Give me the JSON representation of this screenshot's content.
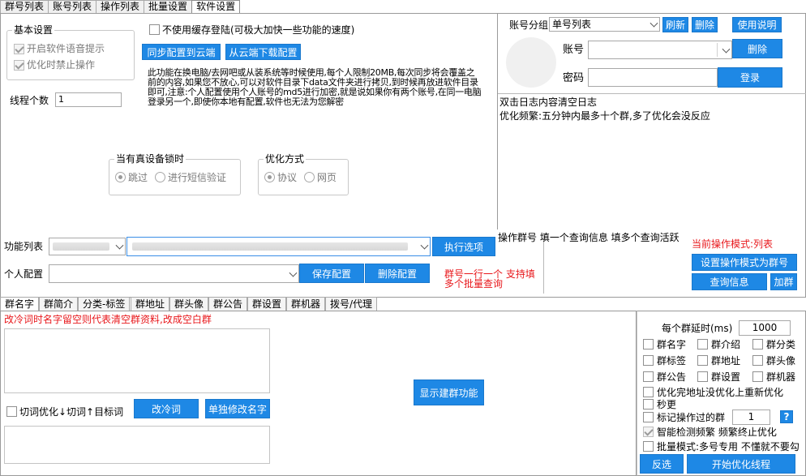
{
  "tabs": [
    "群号列表",
    "账号列表",
    "操作列表",
    "批量设置",
    "软件设置"
  ],
  "settings": {
    "basic_title": "基本设置",
    "voice_prompt": "开启软件语音提示",
    "forbid_optimize": "优化时禁止操作",
    "no_cache_login": "不使用缓存登陆(可极大加快一些功能的速度)",
    "sync_to_cloud": "同步配置到云端",
    "download_from_cloud": "从云端下载配置",
    "description": "此功能在换电脑/去网吧或从装系统等时候使用,每个人限制20MB,每次同步将会覆盖之前的内容,如果您不放心,可以对软件目录下data文件夹进行拷贝,到时候再放进软件目录即可,注意:个人配置使用个人账号的md5进行加密,就是说如果你有两个账号,在同一电脑登录另一个,即使你本地有配置,软件也无法为您解密",
    "thread_label": "线程个数",
    "thread_value": "1",
    "device_lock_title": "当有真设备锁时",
    "skip_label": "跳过",
    "sms_label": "进行短信验证",
    "optimize_mode_title": "优化方式",
    "protocol_label": "协议",
    "web_label": "网页"
  },
  "account": {
    "group_label": "账号分组",
    "group_value": "单号列表",
    "refresh": "刷新",
    "delete": "删除",
    "instructions": "使用说明",
    "account_label": "账号",
    "delete2": "删除",
    "password_label": "密码",
    "login": "登录"
  },
  "log": {
    "line1": "双击日志内容清空日志",
    "line2": "优化频繁:五分钟内最多十个群,多了优化会没反应"
  },
  "func": {
    "func_list_label": "功能列表",
    "execute": "执行选项",
    "personal_label": "个人配置",
    "save_config": "保存配置",
    "delete_config": "删除配置",
    "hint": "群号一行一个 支持填多个批量查询",
    "op_group_header": "操作群号 填一个查询信息 填多个查询活跃",
    "current_mode": "当前操作模式:列表",
    "set_mode": "设置操作模式为群号",
    "query_info": "查询信息",
    "join_group": "加群"
  },
  "bottom_tabs": [
    "群名字",
    "群简介",
    "分类-标签",
    "群地址",
    "群头像",
    "群公告",
    "群设置",
    "群机器",
    "拨号/代理"
  ],
  "bottom": {
    "red_note": "改冷词时名字留空则代表清空群资料,改成空白群",
    "cut_words": "切词优化↓切词↑目标词",
    "change_cold": "改冷词",
    "single_rename": "单独修改名字",
    "show_build": "显示建群功能"
  },
  "right": {
    "delay_label": "每个群延时(ms)",
    "delay_value": "1000",
    "checks": [
      "群名字",
      "群介绍",
      "群分类",
      "群标签",
      "群地址",
      "群头像",
      "群公告",
      "群设置",
      "群机器"
    ],
    "reoptimize": "优化完地址没优化上重新优化",
    "seconds": "秒更",
    "mark_label": "标记操作过的群",
    "mark_value": "1",
    "question": "?",
    "smart_detect": "智能检测频繁 频繁终止优化",
    "batch_mode": "批量模式:多号专用 不懂就不要勾",
    "invert": "反选",
    "start": "开始优化线程"
  },
  "colors": {
    "accent": "#1e88e5",
    "red": "#e8171b"
  }
}
